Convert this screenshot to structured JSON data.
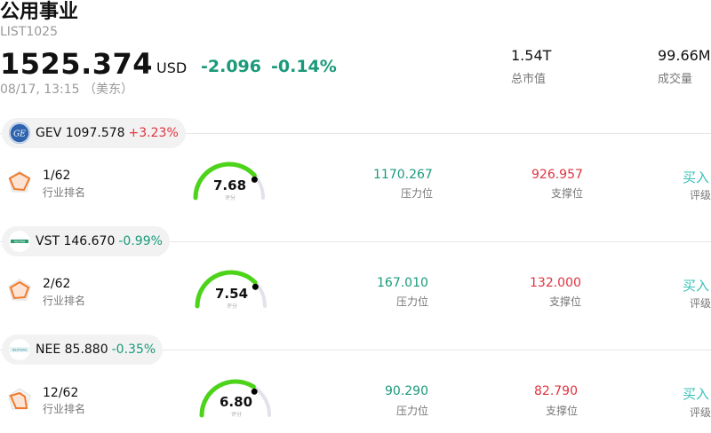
{
  "header": {
    "title": "公用事业",
    "code": "LIST1025",
    "price": "1525.374",
    "currency": "USD",
    "change": "-2.096",
    "change_pct": "-0.14%",
    "timestamp": "08/17, 13:15 （美东）",
    "market_cap_value": "1.54T",
    "market_cap_label": "总市值",
    "volume_value": "99.66M",
    "volume_label": "成交量"
  },
  "colors": {
    "up": "#e0333f",
    "down": "#1a9a7a",
    "gauge": "#4cd31a",
    "buy": "#37c0b7"
  },
  "stocks": [
    {
      "ticker": "GEV",
      "price": "1097.578",
      "pct": "+3.23%",
      "logo_icon": "ge-logo-icon",
      "rank": "1/62",
      "rank_label": "行业排名",
      "score": "7.68",
      "score_label": "评分",
      "score_value": 7.68,
      "resistance": "1170.267",
      "resistance_label": "压力位",
      "support": "926.957",
      "support_label": "支撑位",
      "rating": "买入",
      "rating_label": "评级"
    },
    {
      "ticker": "VST",
      "price": "146.670",
      "pct": "-0.99%",
      "logo_icon": "vistra-logo-icon",
      "rank": "2/62",
      "rank_label": "行业排名",
      "score": "7.54",
      "score_label": "评分",
      "score_value": 7.54,
      "resistance": "167.010",
      "resistance_label": "压力位",
      "support": "132.000",
      "support_label": "支撑位",
      "rating": "买入",
      "rating_label": "评级"
    },
    {
      "ticker": "NEE",
      "price": "85.880",
      "pct": "-0.35%",
      "logo_icon": "nextera-logo-icon",
      "rank": "12/62",
      "rank_label": "行业排名",
      "score": "6.80",
      "score_label": "评分",
      "score_value": 6.8,
      "resistance": "90.290",
      "resistance_label": "压力位",
      "support": "82.790",
      "support_label": "支撑位",
      "rating": "买入",
      "rating_label": "评级"
    }
  ]
}
